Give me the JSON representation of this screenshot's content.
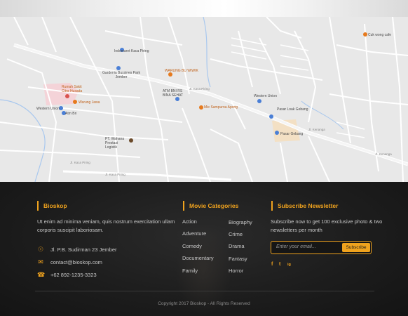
{
  "map": {
    "places": [
      {
        "id": "indomaret",
        "text": "Indomaret Kaca Piring"
      },
      {
        "id": "gardenia",
        "text": "Gardenia Bussines Park Jember"
      },
      {
        "id": "warung-bu-wiwik",
        "text": "WARUNG BU WIWIK"
      },
      {
        "id": "rumah-sakit",
        "text": "Rumah Sakit Citra Husada"
      },
      {
        "id": "warung-jawa",
        "text": "Warung Jawa"
      },
      {
        "id": "western-union-1",
        "text": "Western Union"
      },
      {
        "id": "atm-bri",
        "text": "Atm Bri"
      },
      {
        "id": "atm-bni",
        "text": "ATM BNI RS BINA SEHAT"
      },
      {
        "id": "mie-sampurna",
        "text": "Mie Sampurna Apong"
      },
      {
        "id": "western-union-2",
        "text": "Western Union"
      },
      {
        "id": "pasar-lotak",
        "text": "Pasar Loak Gebang"
      },
      {
        "id": "pasar-gebang",
        "text": "Pasar Gebang"
      },
      {
        "id": "pt-wahana",
        "text": "PT. Wahana Prestasi Logistik"
      },
      {
        "id": "cuk-wong",
        "text": "Cuk wong cafe"
      }
    ],
    "roads": [
      "Jl. Kaca Piring",
      "Jl. Kaca Piring",
      "Jl. Kenanga",
      "Jl. Kenanga",
      "Jl. Kaca Piring"
    ]
  },
  "footer": {
    "brand": {
      "title": "Bioskop",
      "about": "Ut enim ad minima veniam, quis nostrum exercitation ullam corporis suscipit laboriosam.",
      "address": "Jl. P.B. Sudirman 23 Jember",
      "email": "contact@bioskop.com",
      "phone": "+62 892-1235-3323"
    },
    "categories": {
      "title": "Movie Categories",
      "left": [
        "Action",
        "Adventure",
        "Comedy",
        "Documentary",
        "Family"
      ],
      "right": [
        "Biography",
        "Crime",
        "Drama",
        "Fantasy",
        "Horror"
      ]
    },
    "newsletter": {
      "title": "Subscribe Newsletter",
      "text": "Subscribe now to get 100 exclusive photo & two newsletters per month",
      "placeholder": "Enter your email...",
      "button": "Subscribe",
      "social": [
        "f",
        "t",
        "ig"
      ]
    },
    "copyright": "Copyright 2017 Bioskop - All Rights Reserved"
  },
  "colors": {
    "accent": "#f0a31e",
    "footer_bg": "#1d1d1d",
    "map_bg": "#e8e8e8",
    "road": "#ffffff"
  },
  "icons": {
    "address": "map-marker-icon",
    "email": "envelope-icon",
    "phone": "phone-icon",
    "social": [
      "facebook-icon",
      "twitter-icon",
      "instagram-icon"
    ]
  }
}
